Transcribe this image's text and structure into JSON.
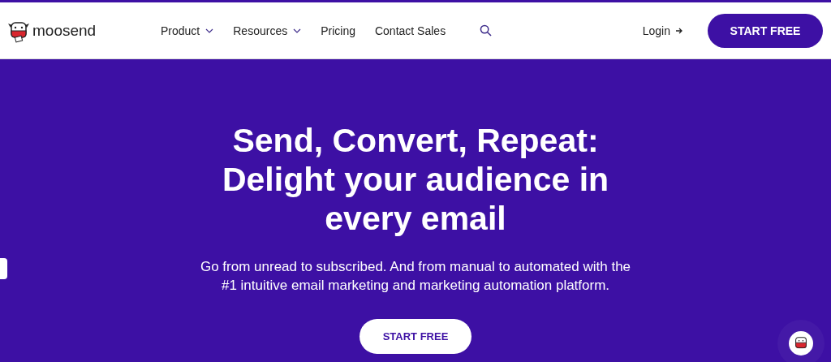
{
  "header": {
    "logo": "moosend",
    "nav": [
      {
        "label": "Product",
        "kind": "dropdown"
      },
      {
        "label": "Resources",
        "kind": "dropdown"
      },
      {
        "label": "Pricing",
        "kind": "link"
      },
      {
        "label": "Contact Sales",
        "kind": "link"
      }
    ],
    "login": "Login",
    "cta": "START FREE"
  },
  "hero": {
    "headline": [
      "Send, Convert, Repeat:",
      "Delight your audience in",
      "every email"
    ],
    "subtext": [
      "Go from unread to subscribed. And from manual to automated with the",
      "#1 intuitive email marketing and marketing automation platform."
    ],
    "cta": "START FREE"
  }
}
